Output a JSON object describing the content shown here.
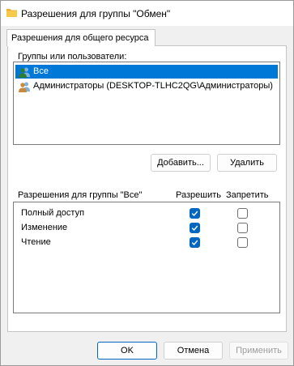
{
  "window": {
    "title": "Разрешения для группы \"Обмен\""
  },
  "tab": {
    "label": "Разрешения для общего ресурса"
  },
  "groups": {
    "label": "Группы или пользователи:",
    "items": [
      {
        "name": "Все",
        "selected": true
      },
      {
        "name": "Администраторы (DESKTOP-TLHC2QG\\Администраторы)",
        "selected": false
      }
    ]
  },
  "buttons": {
    "add": "Добавить...",
    "remove": "Удалить"
  },
  "permissions": {
    "header": "Разрешения для группы \"Все\"",
    "allow_header": "Разрешить",
    "deny_header": "Запретить",
    "rows": [
      {
        "name": "Полный доступ",
        "allow": true,
        "deny": false
      },
      {
        "name": "Изменение",
        "allow": true,
        "deny": false
      },
      {
        "name": "Чтение",
        "allow": true,
        "deny": false
      }
    ]
  },
  "footer": {
    "ok": "OK",
    "cancel": "Отмена",
    "apply": "Применить"
  },
  "colors": {
    "selection": "#0078d7",
    "accent": "#0067c0"
  }
}
